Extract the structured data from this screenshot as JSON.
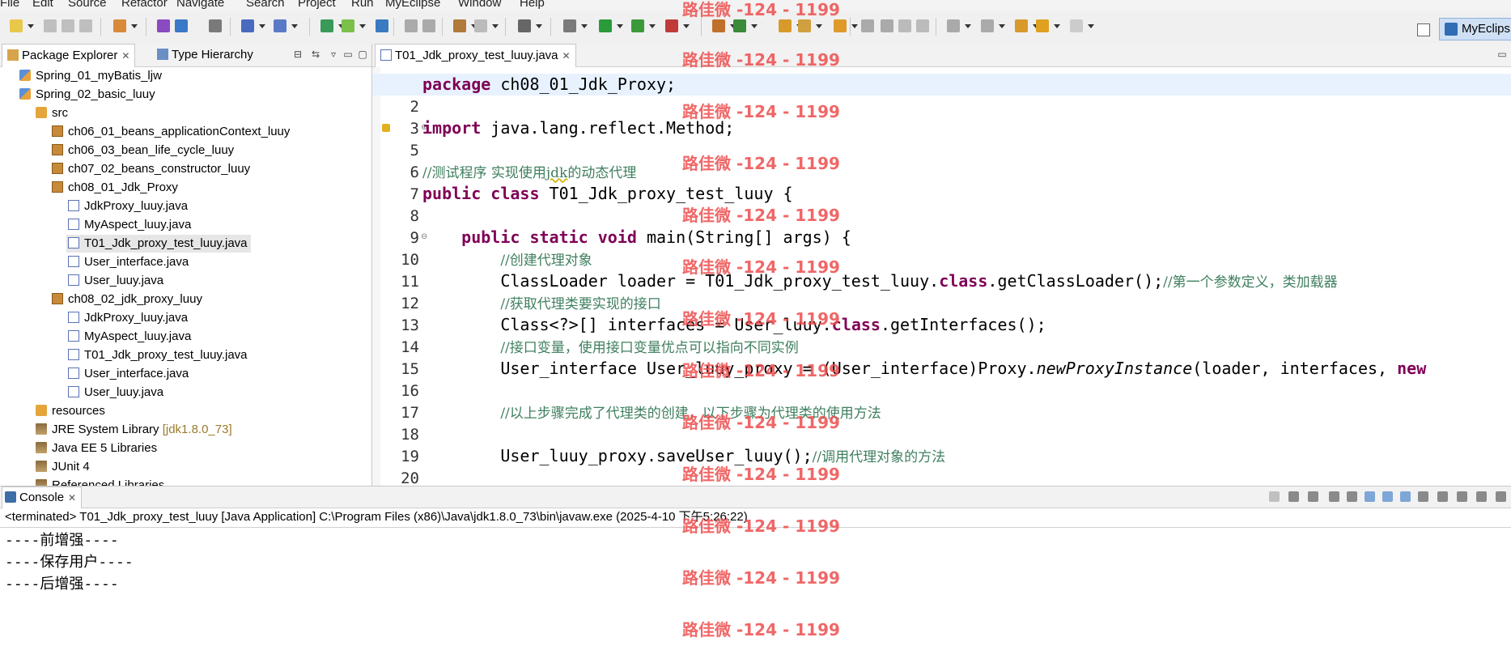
{
  "menu": [
    "File",
    "Edit",
    "Source",
    "Refactor",
    "Navigate",
    "Search",
    "Project",
    "Run",
    "MyEclipse",
    "Window",
    "Help"
  ],
  "perspective": {
    "label": "MyEclips"
  },
  "package_explorer": {
    "tabs": [
      "Package Explorer",
      "Type Hierarchy"
    ],
    "tree": [
      {
        "label": "Spring_01_myBatis_ljw",
        "icon": "project-icon",
        "depth": 0
      },
      {
        "label": "Spring_02_basic_luuy",
        "icon": "project-icon",
        "depth": 0
      },
      {
        "label": "src",
        "icon": "source-folder-icon",
        "depth": 1
      },
      {
        "label": "ch06_01_beans_applicationContext_luuy",
        "icon": "package-icon",
        "depth": 2
      },
      {
        "label": "ch06_03_bean_life_cycle_luuy",
        "icon": "package-icon",
        "depth": 2
      },
      {
        "label": "ch07_02_beans_constructor_luuy",
        "icon": "package-icon",
        "depth": 2
      },
      {
        "label": "ch08_01_Jdk_Proxy",
        "icon": "package-icon",
        "depth": 2
      },
      {
        "label": "JdkProxy_luuy.java",
        "icon": "java-file-icon",
        "depth": 3
      },
      {
        "label": "MyAspect_luuy.java",
        "icon": "java-file-icon",
        "depth": 3
      },
      {
        "label": "T01_Jdk_proxy_test_luuy.java",
        "icon": "java-file-icon",
        "depth": 3,
        "selected": true
      },
      {
        "label": "User_interface.java",
        "icon": "java-file-icon",
        "depth": 3
      },
      {
        "label": "User_luuy.java",
        "icon": "java-file-icon",
        "depth": 3
      },
      {
        "label": "ch08_02_jdk_proxy_luuy",
        "icon": "package-icon",
        "depth": 2
      },
      {
        "label": "JdkProxy_luuy.java",
        "icon": "java-file-icon",
        "depth": 3
      },
      {
        "label": "MyAspect_luuy.java",
        "icon": "java-file-icon",
        "depth": 3
      },
      {
        "label": "T01_Jdk_proxy_test_luuy.java",
        "icon": "java-file-icon",
        "depth": 3
      },
      {
        "label": "User_interface.java",
        "icon": "java-file-icon",
        "depth": 3
      },
      {
        "label": "User_luuy.java",
        "icon": "java-file-icon",
        "depth": 3
      },
      {
        "label": "resources",
        "icon": "source-folder-icon",
        "depth": 1
      },
      {
        "label": "JRE System Library",
        "suffix": "[jdk1.8.0_73]",
        "icon": "library-icon",
        "depth": 1
      },
      {
        "label": "Java EE 5 Libraries",
        "icon": "library-icon",
        "depth": 1
      },
      {
        "label": "JUnit 4",
        "icon": "library-icon",
        "depth": 1
      },
      {
        "label": "Referenced Libraries",
        "icon": "library-icon",
        "depth": 1
      }
    ]
  },
  "editor": {
    "tab": "T01_Jdk_proxy_test_luuy.java",
    "lines": [
      {
        "n": "1",
        "tokens": [
          {
            "t": "kw",
            "v": "package"
          },
          {
            "t": "",
            "v": " ch08_01_Jdk_Proxy;"
          }
        ],
        "current": true
      },
      {
        "n": "2",
        "tokens": []
      },
      {
        "n": "3",
        "tokens": [
          {
            "t": "kw",
            "v": "import"
          },
          {
            "t": "",
            "v": " java.lang.reflect.Method;"
          }
        ]
      },
      {
        "n": "5",
        "tokens": []
      },
      {
        "n": "6",
        "tokens": [
          {
            "t": "cm",
            "v": "//测试程序 实现使用jdk的动态代理"
          }
        ]
      },
      {
        "n": "7",
        "tokens": [
          {
            "t": "kw",
            "v": "public class"
          },
          {
            "t": "",
            "v": " T01_Jdk_proxy_test_luuy {"
          }
        ]
      },
      {
        "n": "8",
        "tokens": []
      },
      {
        "n": "9",
        "tokens": [
          {
            "t": "",
            "v": "    "
          },
          {
            "t": "kw",
            "v": "public static void"
          },
          {
            "t": "",
            "v": " main(String[] args) {"
          }
        ]
      },
      {
        "n": "10",
        "tokens": [
          {
            "t": "",
            "v": "        "
          },
          {
            "t": "cm",
            "v": "//创建代理对象"
          }
        ]
      },
      {
        "n": "11",
        "tokens": [
          {
            "t": "",
            "v": "        ClassLoader loader = T01_Jdk_proxy_test_luuy."
          },
          {
            "t": "kw",
            "v": "class"
          },
          {
            "t": "",
            "v": ".getClassLoader();"
          },
          {
            "t": "cm",
            "v": "//第一个参数定义，类加载器"
          }
        ]
      },
      {
        "n": "12",
        "tokens": [
          {
            "t": "",
            "v": "        "
          },
          {
            "t": "cm",
            "v": "//获取代理类要实现的接口"
          }
        ]
      },
      {
        "n": "13",
        "tokens": [
          {
            "t": "",
            "v": "        Class<?>[] interfaces = User_luuy."
          },
          {
            "t": "kw",
            "v": "class"
          },
          {
            "t": "",
            "v": ".getInterfaces();"
          }
        ]
      },
      {
        "n": "14",
        "tokens": [
          {
            "t": "",
            "v": "        "
          },
          {
            "t": "cm",
            "v": "//接口变量，使用接口变量优点可以指向不同实例"
          }
        ]
      },
      {
        "n": "15",
        "tokens": [
          {
            "t": "",
            "v": "        User_interface User_luuy_proxy = (User_interface)Proxy."
          },
          {
            "t": "it",
            "v": "newProxyInstance"
          },
          {
            "t": "",
            "v": "(loader, interfaces, "
          },
          {
            "t": "kw",
            "v": "new"
          }
        ]
      },
      {
        "n": "16",
        "tokens": []
      },
      {
        "n": "17",
        "tokens": [
          {
            "t": "",
            "v": "        "
          },
          {
            "t": "cm",
            "v": "//以上步骤完成了代理类的创建，以下步骤为代理类的使用方法"
          }
        ]
      },
      {
        "n": "18",
        "tokens": []
      },
      {
        "n": "19",
        "tokens": [
          {
            "t": "",
            "v": "        User_luuy_proxy.saveUser_luuy();"
          },
          {
            "t": "cm",
            "v": "//调用代理对象的方法"
          }
        ]
      },
      {
        "n": "20",
        "tokens": []
      }
    ]
  },
  "console": {
    "tab": "Console",
    "status": "<terminated> T01_Jdk_proxy_test_luuy [Java Application] C:\\Program Files (x86)\\Java\\jdk1.8.0_73\\bin\\javaw.exe (2025-4-10 下午5:26:22)",
    "output": [
      "----前增强----",
      "----保存用户----",
      "----后增强----"
    ]
  },
  "watermark": "路佳微 -124 - 1199",
  "colors": {
    "keyword": "#7f0055",
    "comment": "#3f7f5f",
    "watermark": "#ee4d4d",
    "current_line": "#e8f2fe"
  }
}
